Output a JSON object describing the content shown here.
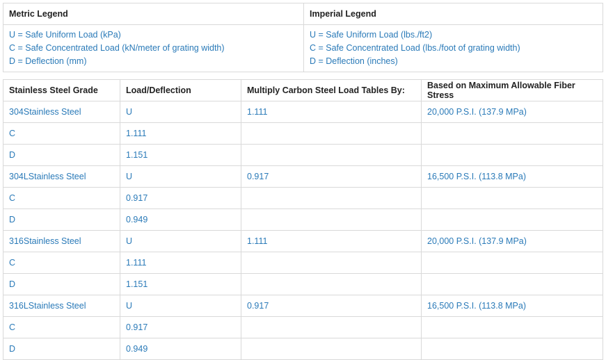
{
  "legend": {
    "metric_title": "Metric Legend",
    "imperial_title": "Imperial Legend",
    "metric_lines": [
      "U = Safe Uniform Load (kPa)",
      "C = Safe Concentrated Load (kN/meter of grating width)",
      "D = Deflection (mm)"
    ],
    "imperial_lines": [
      "U = Safe Uniform Load (lbs./ft2)",
      "C = Safe Concentrated Load (lbs./foot of grating width)",
      "D = Deflection (inches)"
    ]
  },
  "table": {
    "headers": [
      "Stainless Steel Grade",
      "Load/Deflection",
      "Multiply Carbon Steel Load Tables By:",
      "Based on Maximum Allowable Fiber Stress"
    ],
    "rows": [
      [
        "304Stainless Steel",
        "U",
        "1.111",
        "20,000 P.S.I. (137.9 MPa)"
      ],
      [
        "C",
        "1.111",
        "",
        ""
      ],
      [
        "D",
        "1.151",
        "",
        ""
      ],
      [
        "304LStainless Steel",
        "U",
        "0.917",
        "16,500 P.S.I. (113.8 MPa)"
      ],
      [
        "C",
        "0.917",
        "",
        ""
      ],
      [
        "D",
        "0.949",
        "",
        ""
      ],
      [
        "316Stainless Steel",
        "U",
        "1.111",
        "20,000 P.S.I. (137.9 MPa)"
      ],
      [
        "C",
        "1.111",
        "",
        ""
      ],
      [
        "D",
        "1.151",
        "",
        ""
      ],
      [
        "316LStainless Steel",
        "U",
        "0.917",
        "16,500 P.S.I. (113.8 MPa)"
      ],
      [
        "C",
        "0.917",
        "",
        ""
      ],
      [
        "D",
        "0.949",
        "",
        ""
      ]
    ]
  },
  "colors": {
    "link_text": "#2a7ab8",
    "header_text": "#222222",
    "border": "#d9d9d9"
  }
}
